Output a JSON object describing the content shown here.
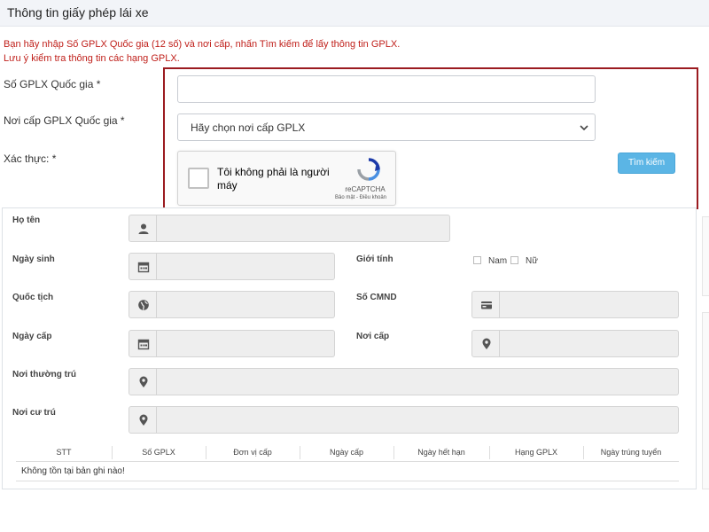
{
  "header": {
    "title": "Thông tin giấy phép lái xe"
  },
  "notice": {
    "line1": "Bạn hãy nhập Số GPLX Quốc gia (12 số) và nơi cấp, nhấn Tìm kiếm để lấy thông tin GPLX.",
    "line2": "Lưu ý kiểm tra thông tin các hạng GPLX."
  },
  "search_form": {
    "gplx_label": "Số GPLX Quốc gia *",
    "gplx_value": "",
    "issuer_label": "Nơi cấp GPLX Quốc gia *",
    "issuer_selected": "Hãy chọn nơi cấp GPLX",
    "verify_label": "Xác thực: *",
    "recaptcha": {
      "checkbox_label": "Tôi không phải là người máy",
      "brand": "reCAPTCHA",
      "links": "Bảo mật - Điều khoản"
    },
    "search_button": "Tìm kiếm"
  },
  "result": {
    "full_name_label": "Họ tên",
    "full_name_value": "",
    "dob_label": "Ngày sinh",
    "dob_value": "",
    "gender_label": "Giới tính",
    "gender_options": [
      "Nam",
      "Nữ"
    ],
    "nationality_label": "Quốc tịch",
    "nationality_value": "",
    "id_label": "Số CMND",
    "id_value": "",
    "issue_date_label": "Ngày cấp",
    "issue_date_value": "",
    "issue_place_label": "Nơi cấp",
    "issue_place_value": "",
    "permanent_addr_label": "Nơi thường trú",
    "permanent_addr_value": "",
    "residence_label": "Nơi cư trú",
    "residence_value": ""
  },
  "table": {
    "columns": [
      "STT",
      "Số GPLX",
      "Đơn vị cấp",
      "Ngày cấp",
      "Ngày hết hạn",
      "Hạng GPLX",
      "Ngày trúng tuyển"
    ],
    "empty_message": "Không tồn tại bản ghi nào!"
  },
  "icons": {
    "user": "user-icon",
    "calendar": "calendar-icon",
    "globe": "globe-icon",
    "id_card": "id-card-icon",
    "location": "map-marker-icon",
    "chevron": "chevron-down-icon",
    "recaptcha": "recaptcha-icon"
  },
  "colors": {
    "notice_text": "#c0201b",
    "highlight_border": "#9b1b20",
    "button_bg": "#5bb5e5",
    "field_bg": "#eeeeee"
  }
}
